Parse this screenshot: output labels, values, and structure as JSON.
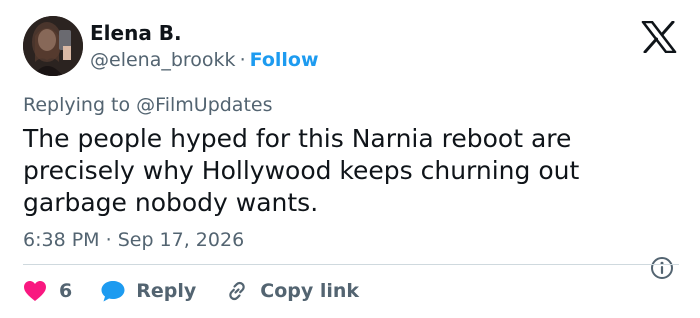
{
  "author": {
    "display_name": "Elena B.",
    "handle": "@elena_brookk",
    "separator": "·",
    "follow_label": "Follow"
  },
  "reply_to": {
    "prefix": "Replying to",
    "mention": "@FilmUpdates"
  },
  "tweet": {
    "text": "The people hyped for this Narnia reboot are precisely why Hollywood keeps churning out garbage nobody wants.",
    "time": "6:38 PM",
    "separator": "·",
    "date": "Sep 17, 2026"
  },
  "actions": {
    "like_count": "6",
    "reply_label": "Reply",
    "copy_label": "Copy link"
  },
  "icons": {
    "logo": "x-logo-icon",
    "info": "info-icon",
    "like": "heart-icon",
    "reply": "speech-bubble-icon",
    "copy": "link-icon"
  },
  "colors": {
    "text": "#0f1419",
    "secondary": "#536471",
    "accent": "#1d9bf0",
    "like": "#f91880",
    "divider": "#cfd9de"
  }
}
